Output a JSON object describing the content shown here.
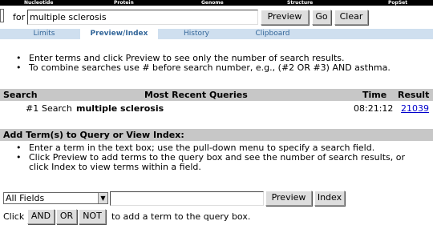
{
  "topnav": {
    "links": [
      "Nucleotide",
      "Protein",
      "Genome",
      "Structure",
      "PopSet"
    ]
  },
  "search": {
    "for_label": "for",
    "query_value": "multiple sclerosis",
    "preview_label": "Preview",
    "go_label": "Go",
    "clear_label": "Clear"
  },
  "tabs": [
    "Limits",
    "Preview/Index",
    "History",
    "Clipboard"
  ],
  "active_tab": "Preview/Index",
  "intro": {
    "lines": [
      "Enter terms and click Preview to see only the number of search results.",
      "To combine searches use # before search number, e.g., (#2 OR #3) AND asthma."
    ]
  },
  "history": {
    "headers": {
      "search": "Search",
      "queries": "Most Recent Queries",
      "time": "Time",
      "result": "Result"
    },
    "rows": [
      {
        "number": "#1",
        "prefix": "Search",
        "term": "multiple sclerosis",
        "time": "08:21:12",
        "result": "21039"
      }
    ]
  },
  "index_section": {
    "heading": "Add Term(s) to Query or View Index:",
    "lines": [
      "Enter a term in the text box; use the pull-down menu to specify a search field.",
      "Click Preview to add terms to the query box and see the number of search results, or",
      "click Index to view terms within a field."
    ],
    "field_value": "All Fields",
    "preview_label": "Preview",
    "index_label": "Index",
    "click_label": "Click",
    "and_label": "AND",
    "or_label": "OR",
    "not_label": "NOT",
    "tail_text": "to add a term to the query box."
  },
  "colors": {
    "tab_bar": "#cfdfef",
    "tab_text": "#336699",
    "header_bg": "#c7c7c7",
    "link": "#0000cc"
  }
}
